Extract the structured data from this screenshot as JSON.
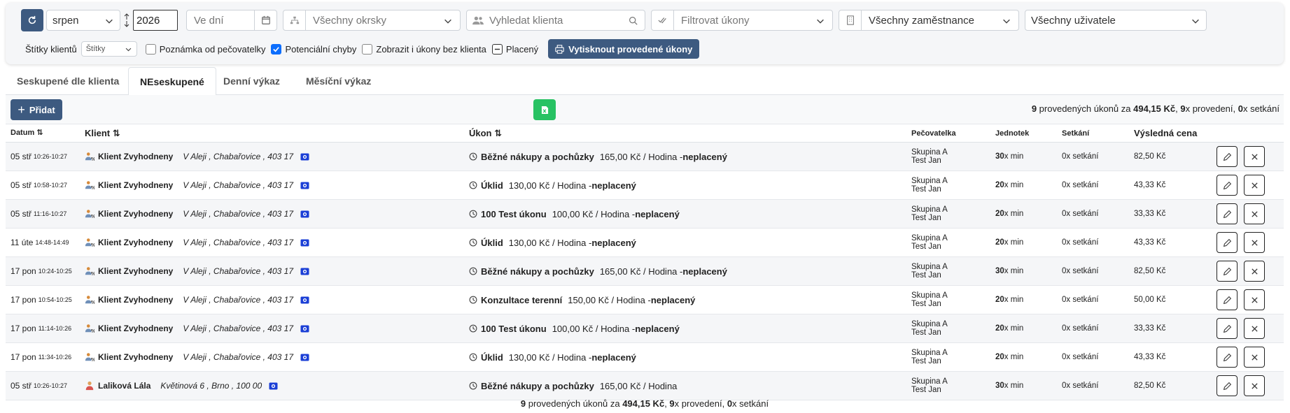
{
  "filters": {
    "month": "srpen",
    "year": "2026",
    "days_placeholder": "Ve dní",
    "district": "Všechny okrsky",
    "client_search_placeholder": "Vyhledat klienta",
    "tasks_filter": "Filtrovat úkony",
    "employees": "Všechny zaměstnance",
    "users": "Všechny uživatele",
    "client_tags_label": "Štítky klientů",
    "tags_select": "Štítky",
    "checkboxes": [
      {
        "label": "Poznámka od pečovatelky",
        "checked": false
      },
      {
        "label": "Potenciální chyby",
        "checked": true
      },
      {
        "label": "Zobrazit i úkony bez klienta",
        "checked": false
      },
      {
        "label": "Placený",
        "checked": "indeterminate"
      }
    ],
    "print_button": "Vytisknout provedené úkony"
  },
  "tabs": [
    {
      "label": "Seskupené dle klienta",
      "active": false
    },
    {
      "label": "NEseskupené",
      "active": true
    },
    {
      "label": "Denní výkaz",
      "active": false
    },
    {
      "label": "Měsíční výkaz",
      "active": false
    }
  ],
  "toolbar": {
    "add_button": "Přidat",
    "summary": {
      "count": "9",
      "t1": " provedených úkonů za ",
      "total": "494,15 Kč",
      "t2": ", ",
      "done": "9",
      "t3": "x provedení, ",
      "sets": "0",
      "t4": "x setkání"
    }
  },
  "table": {
    "headers": {
      "date": "Datum",
      "client": "Klient",
      "task": "Úkon",
      "caregiver": "Pečovatelka",
      "units": "Jednotek",
      "meetings": "Setkání",
      "price": "Výsledná cena"
    },
    "rows": [
      {
        "day": "05 stř",
        "time": "10:26-10:27",
        "client": "Klient Zvyhodneny",
        "address": "V Aleji , Chabařovice , 403 17",
        "icon": "discount-user-icon",
        "task": "Běžné nákupy a pochůzky",
        "rate": "165,00 Kč / Hodina - ",
        "paid": "neplacený",
        "group": "Skupina A",
        "worker": "Test Jan",
        "units": "30",
        "unit_suffix": "x min",
        "meetings": "0x setkání",
        "price": "82,50 Kč"
      },
      {
        "day": "05 stř",
        "time": "10:58-10:27",
        "client": "Klient Zvyhodneny",
        "address": "V Aleji , Chabařovice , 403 17",
        "icon": "discount-user-icon",
        "task": "Úklid",
        "rate": "130,00 Kč / Hodina - ",
        "paid": "neplacený",
        "group": "Skupina A",
        "worker": "Test Jan",
        "units": "20",
        "unit_suffix": "x min",
        "meetings": "0x setkání",
        "price": "43,33 Kč"
      },
      {
        "day": "05 stř",
        "time": "11:16-10:27",
        "client": "Klient Zvyhodneny",
        "address": "V Aleji , Chabařovice , 403 17",
        "icon": "discount-user-icon",
        "task": "100 Test úkonu",
        "rate": "100,00 Kč / Hodina - ",
        "paid": "neplacený",
        "group": "Skupina A",
        "worker": "Test Jan",
        "units": "20",
        "unit_suffix": "x min",
        "meetings": "0x setkání",
        "price": "33,33 Kč"
      },
      {
        "day": "11 úte",
        "time": "14:48-14:49",
        "client": "Klient Zvyhodneny",
        "address": "V Aleji , Chabařovice , 403 17",
        "icon": "discount-user-icon",
        "task": "Úklid",
        "rate": "130,00 Kč / Hodina - ",
        "paid": "neplacený",
        "group": "Skupina A",
        "worker": "Test Jan",
        "units": "20",
        "unit_suffix": "x min",
        "meetings": "0x setkání",
        "price": "43,33 Kč"
      },
      {
        "day": "17 pon",
        "time": "10:24-10:25",
        "client": "Klient Zvyhodneny",
        "address": "V Aleji , Chabařovice , 403 17",
        "icon": "discount-user-icon",
        "task": "Běžné nákupy a pochůzky",
        "rate": "165,00 Kč / Hodina - ",
        "paid": "neplacený",
        "group": "Skupina A",
        "worker": "Test Jan",
        "units": "30",
        "unit_suffix": "x min",
        "meetings": "0x setkání",
        "price": "82,50 Kč"
      },
      {
        "day": "17 pon",
        "time": "10:54-10:25",
        "client": "Klient Zvyhodneny",
        "address": "V Aleji , Chabařovice , 403 17",
        "icon": "discount-user-icon",
        "task": "Konzultace terenní",
        "rate": "150,00 Kč / Hodina - ",
        "paid": "neplacený",
        "group": "Skupina A",
        "worker": "Test Jan",
        "units": "20",
        "unit_suffix": "x min",
        "meetings": "0x setkání",
        "price": "50,00 Kč"
      },
      {
        "day": "17 pon",
        "time": "11:14-10:26",
        "client": "Klient Zvyhodneny",
        "address": "V Aleji , Chabařovice , 403 17",
        "icon": "discount-user-icon",
        "task": "100 Test úkonu",
        "rate": "100,00 Kč / Hodina - ",
        "paid": "neplacený",
        "group": "Skupina A",
        "worker": "Test Jan",
        "units": "20",
        "unit_suffix": "x min",
        "meetings": "0x setkání",
        "price": "33,33 Kč"
      },
      {
        "day": "17 pon",
        "time": "11:34-10:26",
        "client": "Klient Zvyhodneny",
        "address": "V Aleji , Chabařovice , 403 17",
        "icon": "discount-user-icon",
        "task": "Úklid",
        "rate": "130,00 Kč / Hodina - ",
        "paid": "neplacený",
        "group": "Skupina A",
        "worker": "Test Jan",
        "units": "20",
        "unit_suffix": "x min",
        "meetings": "0x setkání",
        "price": "43,33 Kč"
      },
      {
        "day": "05 stř",
        "time": "10:26-10:27",
        "client": "Laliková Lála",
        "address": "Květinová 6 , Brno , 100 00",
        "icon": "person-icon",
        "task": "Běžné nákupy a pochůzky",
        "rate": "165,00 Kč / Hodina",
        "paid": "",
        "group": "Skupina A",
        "worker": "Test Jan",
        "units": "30",
        "unit_suffix": "x min",
        "meetings": "0x setkání",
        "price": "82,50 Kč"
      }
    ]
  },
  "colors": {
    "primary": "#3d5a80",
    "success": "#28c263",
    "checkbox": "#0d6efd",
    "id_badge": "#1b3fd6"
  }
}
